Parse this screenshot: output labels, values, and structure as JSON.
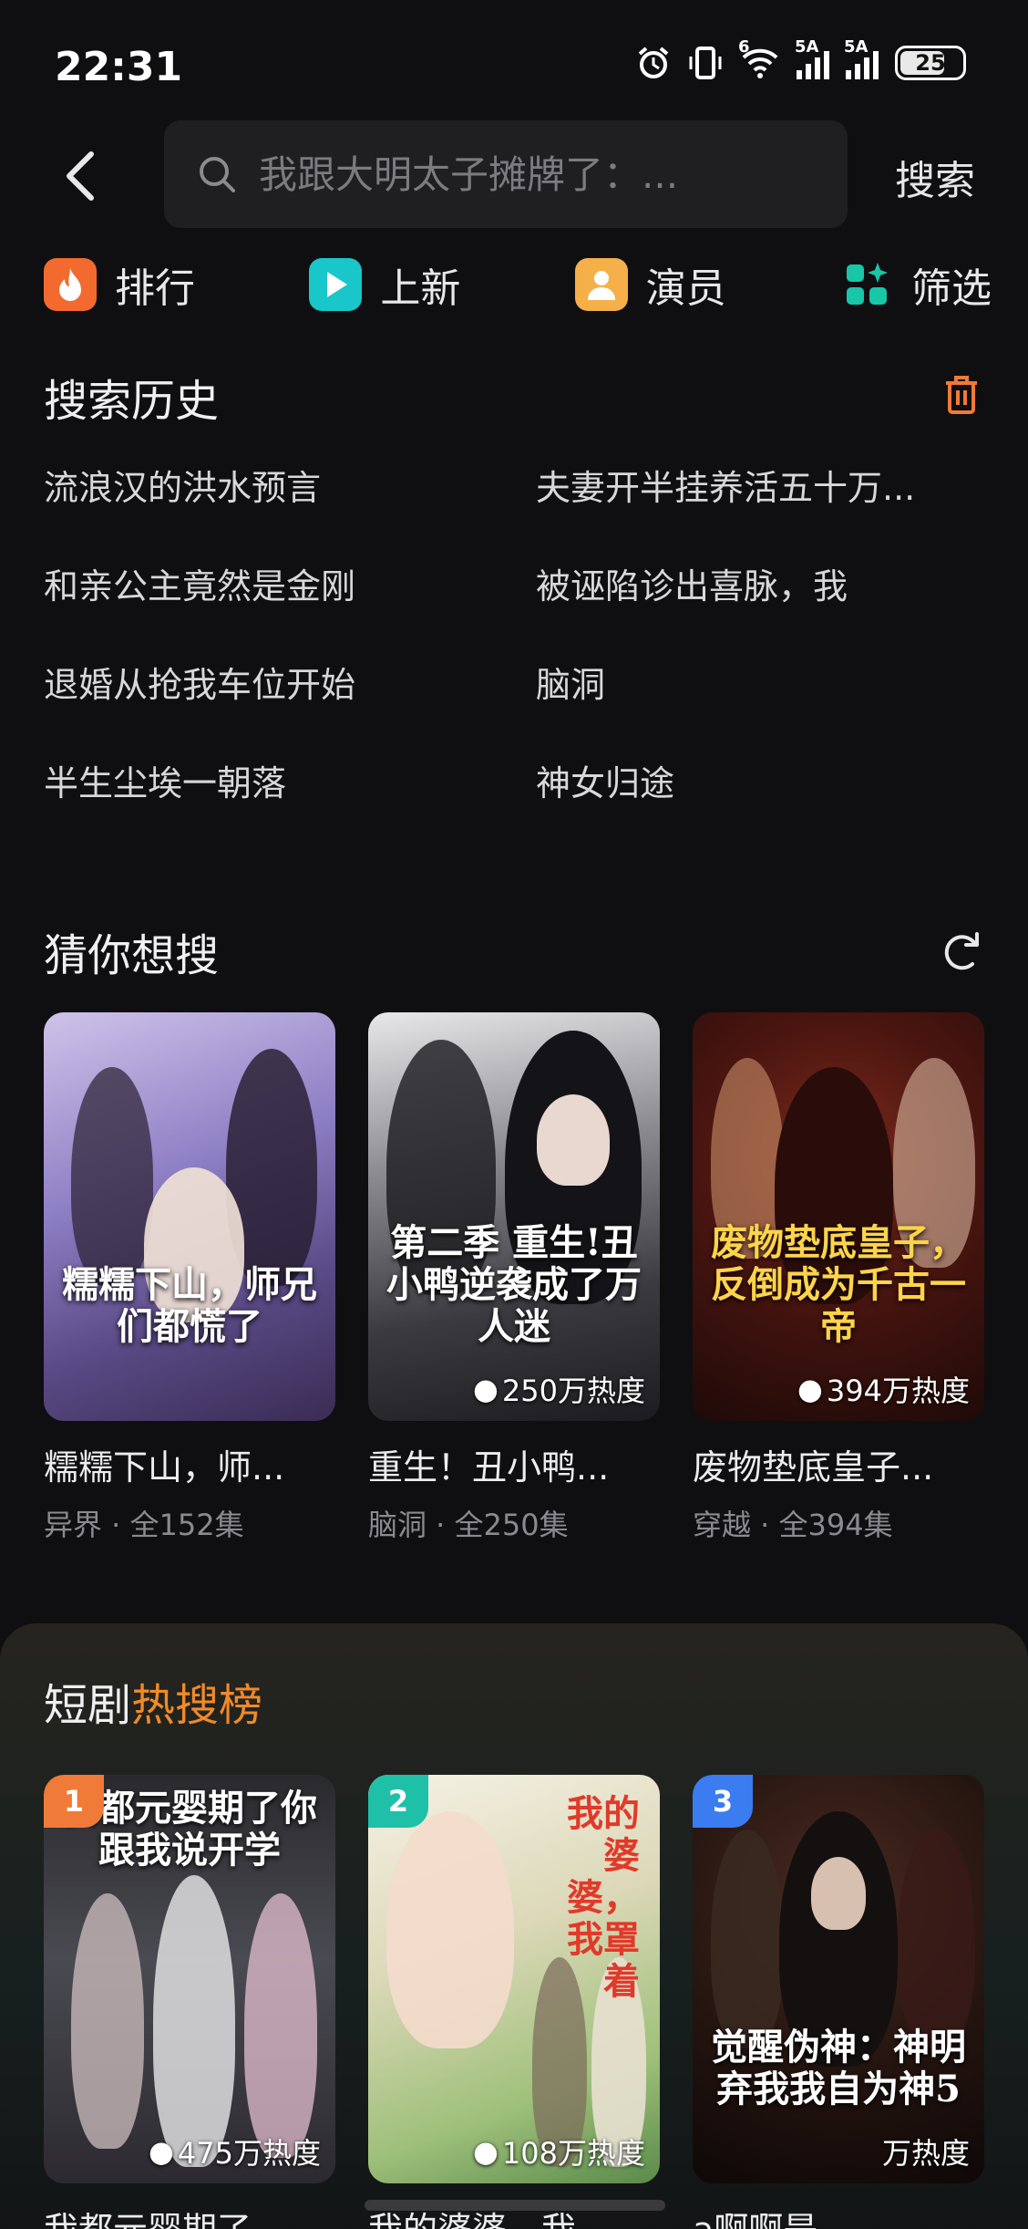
{
  "status": {
    "time": "22:31",
    "battery": "25",
    "net1": "5A",
    "net2": "5A",
    "wifi_gen": "6"
  },
  "search": {
    "placeholder": "我跟大明太子摊牌了：...",
    "button": "搜索"
  },
  "quick_nav": [
    {
      "label": "排行",
      "icon": "flame-icon",
      "color": "#f26a2e"
    },
    {
      "label": "上新",
      "icon": "play-icon",
      "color": "#19c6c9"
    },
    {
      "label": "演员",
      "icon": "person-icon",
      "color": "#f6b04a"
    },
    {
      "label": "筛选",
      "icon": "filter-icon",
      "color": "#19c6a8"
    }
  ],
  "history": {
    "title": "搜索历史",
    "items": [
      "流浪汉的洪水预言",
      "夫妻开半挂养活五十万...",
      "和亲公主竟然是金刚",
      "被诬陷诊出喜脉，我",
      "退婚从抢我车位开始",
      "脑洞",
      "半生尘埃一朝落",
      "神女归途"
    ]
  },
  "guess": {
    "title": "猜你想搜",
    "cards": [
      {
        "poster_text": "糯糯下山，师兄们都慌了",
        "heat": "",
        "title": "糯糯下山，师...",
        "meta": "异界 · 全152集"
      },
      {
        "poster_text": "第二季 重生!丑小鸭逆袭成了万人迷",
        "heat": "250万热度",
        "title": "重生！丑小鸭...",
        "meta": "脑洞 · 全250集"
      },
      {
        "poster_text": "废物垫底皇子，反倒成为千古一帝",
        "heat": "394万热度",
        "title": "废物垫底皇子...",
        "meta": "穿越 · 全394集"
      }
    ]
  },
  "hot": {
    "title_prefix": "短剧",
    "title_accent": "热搜榜",
    "accent_color": "#f08a2a",
    "cards": [
      {
        "rank": "1",
        "rank_color": "#f07a38",
        "poster_text": "我都元婴期了你跟我说开学",
        "heat": "475万热度",
        "title": "我都元婴期了"
      },
      {
        "rank": "2",
        "rank_color": "#1fc0a8",
        "poster_text": "我的婆婆，我罩着",
        "heat": "108万热度",
        "title": "我的婆婆，我"
      },
      {
        "rank": "3",
        "rank_color": "#3b7cf0",
        "poster_text": "觉醒伪神：神明弃我我自为神5",
        "heat": "万热度",
        "title": "a啊啊是"
      }
    ]
  }
}
